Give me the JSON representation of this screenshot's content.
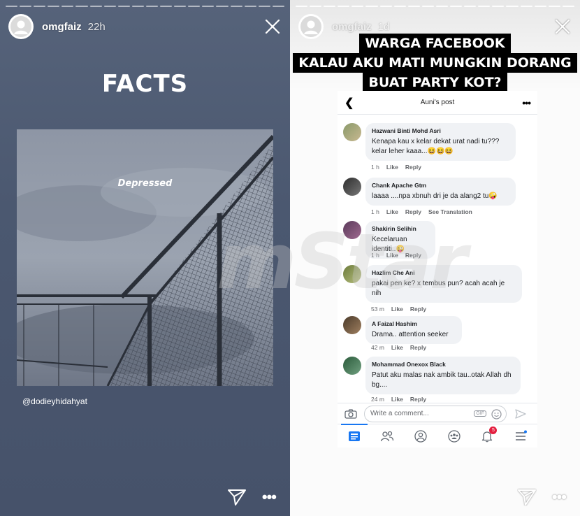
{
  "left_story": {
    "username": "omgfaiz",
    "time": "22h",
    "heading": "FACTS",
    "photo_caption": "Depressed",
    "credit": "@dodieyhidahyat"
  },
  "right_story": {
    "username": "omgfaiz",
    "time": "1d",
    "headline": [
      "WARGA FACEBOOK",
      "KALAU AKU MATI MUNGKIN DORANG",
      "BUAT PARTY KOT?"
    ]
  },
  "fb_post": {
    "title": "Auni's post",
    "comments": [
      {
        "name": "Hazwani Binti Mohd Asri",
        "text": "Kenapa kau x kelar dekat urat nadi tu??? kelar leher kaaa...😆😆😆",
        "time": "1 h",
        "like": "Like",
        "reply": "Reply",
        "extra": ""
      },
      {
        "name": "Chank Apache Gtm",
        "text": "laaaa ....npa xbnuh dri je da alang2 tu🤪",
        "time": "1 h",
        "like": "Like",
        "reply": "Reply",
        "extra": "See Translation"
      },
      {
        "name": "Shakirin Selihin",
        "text": "Kecelaruan identiti..😜",
        "time": "1 h",
        "like": "Like",
        "reply": "Reply",
        "extra": ""
      },
      {
        "name": "Hazlim Che Ani",
        "text": "pakai pen ke? x tembus pun? acah acah je nih",
        "time": "53 m",
        "like": "Like",
        "reply": "Reply",
        "extra": ""
      },
      {
        "name": "A Faizal Hashim",
        "text": "Drama.. attention seeker",
        "time": "42 m",
        "like": "Like",
        "reply": "Reply",
        "extra": ""
      },
      {
        "name": "Mohammad Onexox Black",
        "text": "Patut aku malas nak ambik tau..otak Allah dh bg....",
        "time": "24 m",
        "like": "Like",
        "reply": "Reply",
        "extra": ""
      }
    ],
    "comment_placeholder": "Write a comment...",
    "gif_label": "GIF",
    "notification_count": "5"
  },
  "watermark": "mStar",
  "icons": {
    "close": "close-icon",
    "send": "paper-plane-icon",
    "more": "more-dots-icon"
  },
  "colors": {
    "fb_blue": "#1877f2",
    "bubble": "#f0f2f5",
    "badge_red": "#e41e3f"
  }
}
